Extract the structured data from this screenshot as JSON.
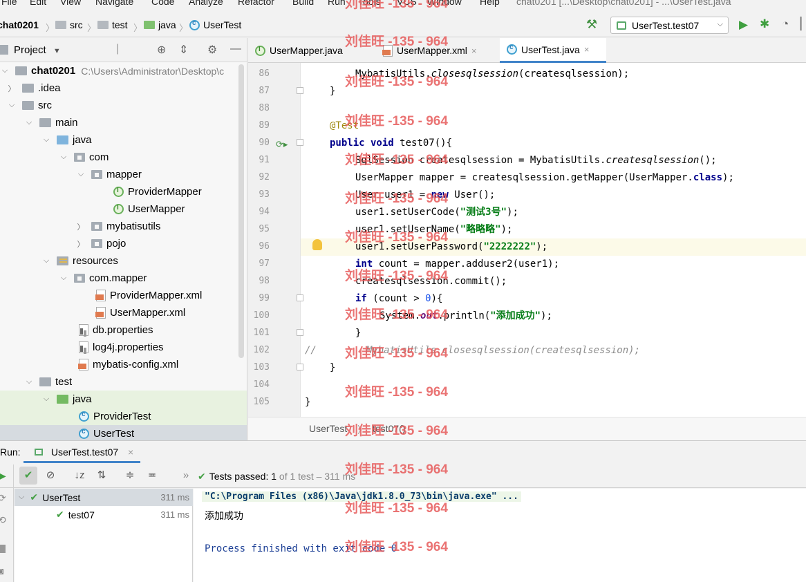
{
  "menu": [
    "File",
    "Edit",
    "View",
    "Navigate",
    "Code",
    "Analyze",
    "Refactor",
    "Build",
    "Run",
    "Tools",
    "VCS",
    "Window",
    "Help"
  ],
  "window_title": "chat0201 [...\\Desktop\\chat0201] - ...\\UserTest.java",
  "breadcrumbs": [
    "chat0201",
    "src",
    "test",
    "java",
    "UserTest"
  ],
  "run_config": "UserTest.test07",
  "project_panel": {
    "title": "Project",
    "tree": [
      {
        "label": "chat0201",
        "hint": "C:\\Users\\Administrator\\Desktop\\c",
        "icon": "module"
      },
      {
        "label": ".idea",
        "icon": "folder"
      },
      {
        "label": "src",
        "icon": "folder"
      },
      {
        "label": "main",
        "icon": "folder"
      },
      {
        "label": "java",
        "icon": "folder-blue"
      },
      {
        "label": "com",
        "icon": "package"
      },
      {
        "label": "mapper",
        "icon": "package"
      },
      {
        "label": "ProviderMapper",
        "icon": "interface"
      },
      {
        "label": "UserMapper",
        "icon": "interface"
      },
      {
        "label": "mybatisutils",
        "icon": "package"
      },
      {
        "label": "pojo",
        "icon": "package"
      },
      {
        "label": "resources",
        "icon": "resources"
      },
      {
        "label": "com.mapper",
        "icon": "package"
      },
      {
        "label": "ProviderMapper.xml",
        "icon": "xml"
      },
      {
        "label": "UserMapper.xml",
        "icon": "xml"
      },
      {
        "label": "db.properties",
        "icon": "properties"
      },
      {
        "label": "log4j.properties",
        "icon": "properties"
      },
      {
        "label": "mybatis-config.xml",
        "icon": "xml"
      },
      {
        "label": "test",
        "icon": "folder"
      },
      {
        "label": "java",
        "icon": "folder-green"
      },
      {
        "label": "ProviderTest",
        "icon": "class"
      },
      {
        "label": "UserTest",
        "icon": "class"
      }
    ]
  },
  "editor": {
    "tabs": [
      {
        "label": "UserMapper.java",
        "close": ""
      },
      {
        "label": "UserMapper.xml",
        "close": "×"
      },
      {
        "label": "UserTest.java",
        "close": "×"
      }
    ],
    "line_numbers": [
      "86",
      "87",
      "88",
      "89",
      "90",
      "91",
      "92",
      "93",
      "94",
      "95",
      "96",
      "97",
      "98",
      "99",
      "100",
      "101",
      "102",
      "103",
      "104",
      "105"
    ],
    "code": {
      "l86": {
        "a": "MybatisUtils.",
        "b": "closesqlsession",
        "c": "(createsqlsession);"
      },
      "l87": "}",
      "l89": "@Test",
      "l90": {
        "kw": "public void",
        "rest": " test07(){"
      },
      "l91": {
        "a": "SqlSession createsqlsession = MybatisUtils.",
        "b": "createsqlsession",
        "c": "();"
      },
      "l92": {
        "a": "UserMapper mapper = createsqlsession.getMapper(UserMapper.",
        "kw": "class",
        "c": ");"
      },
      "l93": {
        "a": "User user1 = ",
        "kw": "new",
        "c": " User();"
      },
      "l94": {
        "a": "user1.setUserCode(",
        "s": "\"测试3号\"",
        "c": ");"
      },
      "l95": {
        "a": "user1.setUserName(",
        "s": "\"略略略\"",
        "c": ");"
      },
      "l96": {
        "a": "user1.setUserPassword(",
        "s": "\"2222222\"",
        "c": ");"
      },
      "l97": {
        "kw": "int",
        "rest": " count = mapper.adduser2(user1);"
      },
      "l98": "createsqlsession.commit();",
      "l99": {
        "kw": "if",
        "rest": " (count > ",
        "n": "0",
        "c": "){"
      },
      "l100": {
        "a": "System.",
        "f": "out",
        "b": ".println(",
        "s": "\"添加成功\"",
        "c": ");"
      },
      "l101": "}",
      "l102": {
        "slashes": "//",
        "rest": "MybatisUtils.closesqlsession(createsqlsession);"
      },
      "l103": "}",
      "l105": "}"
    },
    "breadcrumb": [
      "UserTest",
      "test07()"
    ]
  },
  "run_panel": {
    "label": "Run:",
    "tab": "UserTest.test07",
    "tab_close": "×",
    "status": {
      "prefix": "Tests passed:",
      "count": "1",
      "suffix": "of 1 test – 311 ms"
    },
    "results": [
      {
        "name": "UserTest",
        "time": "311 ms"
      },
      {
        "name": "test07",
        "time": "311 ms"
      }
    ],
    "console": [
      "\"C:\\Program Files (x86)\\Java\\jdk1.8.0_73\\bin\\java.exe\" ...",
      "添加成功",
      "Process finished with exit code 0"
    ]
  },
  "watermark": "刘佳旺 -135 - 964",
  "colors": {
    "accent": "#4083c9",
    "pass": "#45a045",
    "keyword": "#00008b",
    "string": "#067d17",
    "watermark": "#e65a5a"
  }
}
